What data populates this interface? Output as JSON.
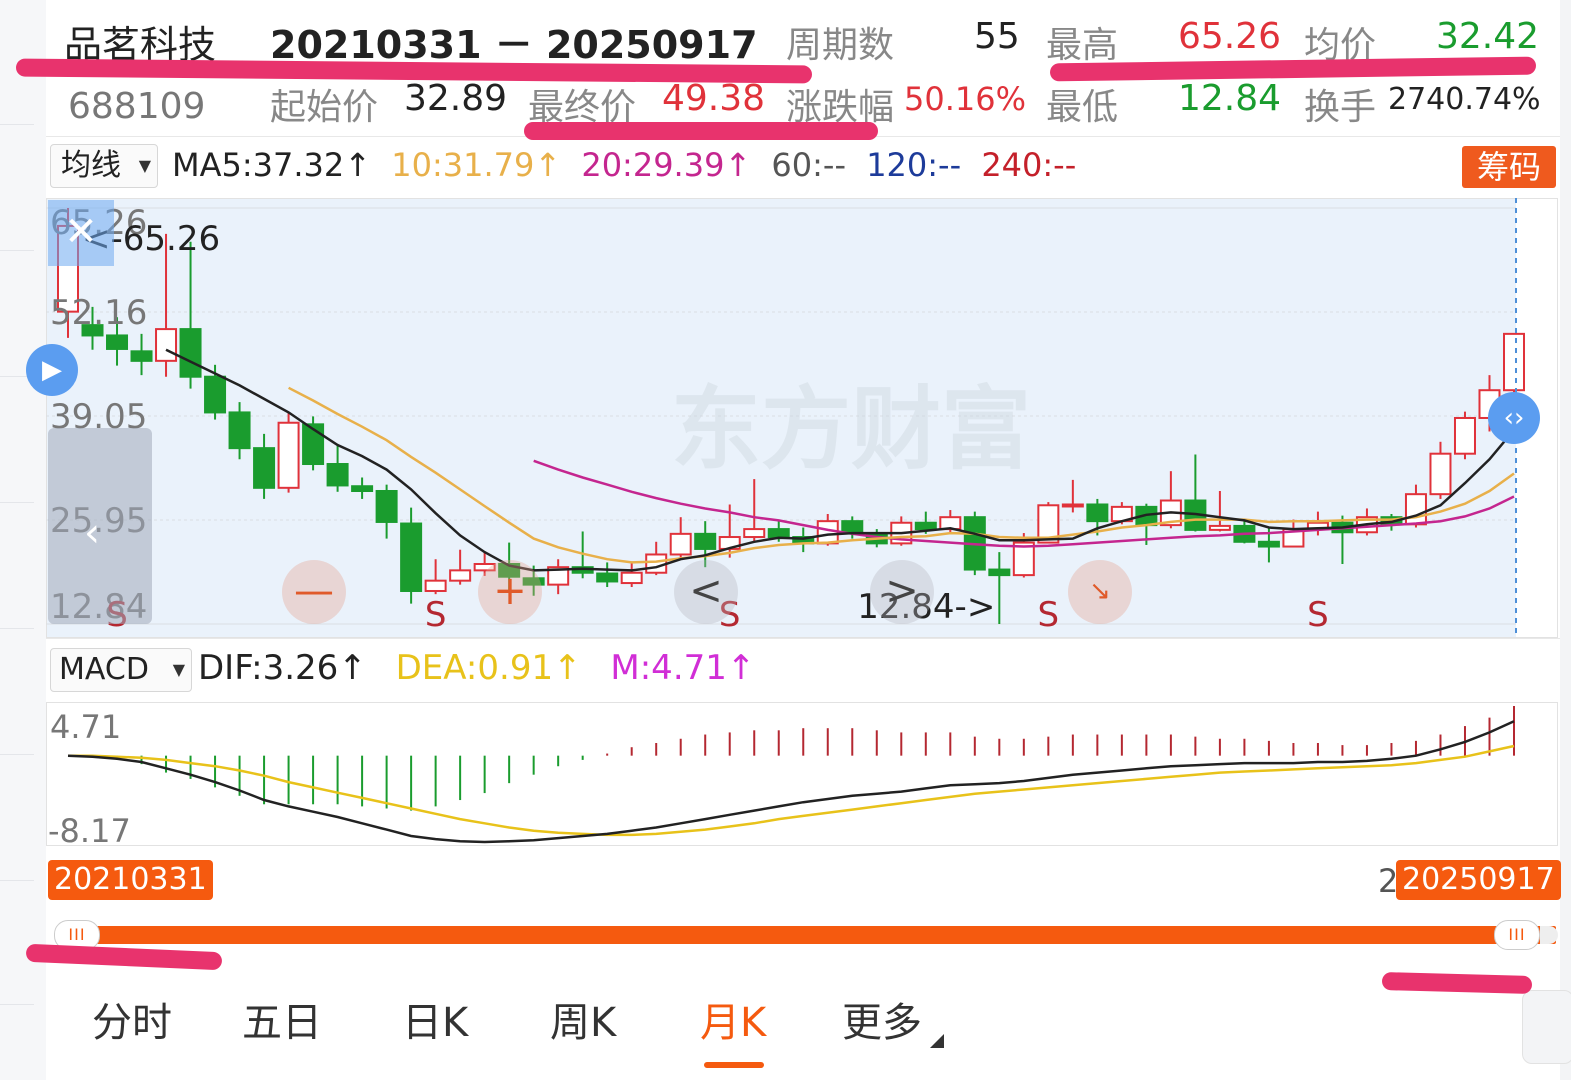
{
  "header": {
    "stock_name": "品茗科技",
    "date_range": "20210331 － 20250917",
    "stock_code": "688109",
    "periods_label": "周期数",
    "periods_value": "55",
    "high_label": "最高",
    "high_value": "65.26",
    "avg_label": "均价",
    "avg_value": "32.42",
    "start_label": "起始价",
    "start_value": "32.89",
    "end_label": "最终价",
    "end_value": "49.38",
    "change_label": "涨跌幅",
    "change_value": "50.16%",
    "low_label": "最低",
    "low_value": "12.84",
    "turnover_label": "换手",
    "turnover_value": "2740.74%"
  },
  "ma_bar": {
    "selector": "均线",
    "ma5": "MA5:37.32↑",
    "ma10": "10:31.79↑",
    "ma20": "20:29.39↑",
    "ma60": "60:--",
    "ma120": "120:--",
    "ma240": "240:--",
    "chip_button": "筹码"
  },
  "colors": {
    "up": "#e0323a",
    "down": "#1a9c2e",
    "ma5": "#222222",
    "ma10": "#e8b04a",
    "ma20": "#c4268f",
    "ma60": "#555555",
    "ma120": "#1d3b9a",
    "ma240": "#c4202a",
    "accent": "#f55a0f"
  },
  "main_chart": {
    "y_labels": [
      "65.26",
      "52.16",
      "39.05",
      "25.95",
      "12.84"
    ],
    "high_marker": "<-65.26",
    "low_marker": "12.84->",
    "watermark": "东方财富",
    "s_markers": [
      "S",
      "S",
      "S",
      "S",
      "S"
    ],
    "zoom_out": "—",
    "zoom_in": "+",
    "prev": "<",
    "next": ">"
  },
  "macd_bar": {
    "selector": "MACD",
    "dif": "DIF:3.26↑",
    "dea": "DEA:0.91↑",
    "m": "M:4.71↑",
    "y_top": "4.71",
    "y_bottom": "-8.17"
  },
  "range_slider": {
    "start": "20210331",
    "end": "20250917",
    "handle_glyph": "III"
  },
  "tabs": [
    {
      "label": "分时",
      "active": false
    },
    {
      "label": "五日",
      "active": false
    },
    {
      "label": "日K",
      "active": false
    },
    {
      "label": "周K",
      "active": false
    },
    {
      "label": "月K",
      "active": true
    },
    {
      "label": "更多",
      "active": false
    }
  ],
  "chart_data": {
    "type": "candlestick",
    "ylim": [
      12.84,
      65.26
    ],
    "candles": [
      [
        52.2,
        63.0,
        65.26,
        48.9
      ],
      [
        50.5,
        49.2,
        52.8,
        47.4
      ],
      [
        49.2,
        47.5,
        51.5,
        45.4
      ],
      [
        47.2,
        46.0,
        49.4,
        44.2
      ],
      [
        46.0,
        50.0,
        62.0,
        44.0
      ],
      [
        50.0,
        44.0,
        61.0,
        42.5
      ],
      [
        44.0,
        39.5,
        45.5,
        38.6
      ],
      [
        39.5,
        35.0,
        40.8,
        33.6
      ],
      [
        35.0,
        30.0,
        36.8,
        28.6
      ],
      [
        30.0,
        38.2,
        39.5,
        29.4
      ],
      [
        38.0,
        33.0,
        39.0,
        32.2
      ],
      [
        33.0,
        30.3,
        35.5,
        29.5
      ],
      [
        30.2,
        29.6,
        31.3,
        28.6
      ],
      [
        29.6,
        25.7,
        30.4,
        23.6
      ],
      [
        25.5,
        17.0,
        27.5,
        15.4
      ],
      [
        17.0,
        18.3,
        21.0,
        16.6
      ],
      [
        18.3,
        19.6,
        22.2,
        17.8
      ],
      [
        19.6,
        20.4,
        21.9,
        18.9
      ],
      [
        20.4,
        18.8,
        23.1,
        17.0
      ],
      [
        18.6,
        17.8,
        20.2,
        16.4
      ],
      [
        17.8,
        20.0,
        21.0,
        16.6
      ],
      [
        20.0,
        19.3,
        24.5,
        18.6
      ],
      [
        19.2,
        18.2,
        20.6,
        17.5
      ],
      [
        18.0,
        19.3,
        20.6,
        17.5
      ],
      [
        19.3,
        21.6,
        23.2,
        19.0
      ],
      [
        21.6,
        24.2,
        26.3,
        21.2
      ],
      [
        24.2,
        22.3,
        25.8,
        20.0
      ],
      [
        22.3,
        23.8,
        27.9,
        21.2
      ],
      [
        23.8,
        24.8,
        31.1,
        23.2
      ],
      [
        24.8,
        23.8,
        26.0,
        23.2
      ],
      [
        23.8,
        23.0,
        25.0,
        21.9
      ],
      [
        23.0,
        25.8,
        26.7,
        22.7
      ],
      [
        25.8,
        24.3,
        26.4,
        23.6
      ],
      [
        24.3,
        23.0,
        24.8,
        22.5
      ],
      [
        23.0,
        25.6,
        26.4,
        22.7
      ],
      [
        25.6,
        24.8,
        27.0,
        24.2
      ],
      [
        24.8,
        26.3,
        27.2,
        24.3
      ],
      [
        26.3,
        19.7,
        27.0,
        19.0
      ],
      [
        19.7,
        19.0,
        21.9,
        12.84
      ],
      [
        19.0,
        23.1,
        24.3,
        18.7
      ],
      [
        23.1,
        27.8,
        28.2,
        23.0
      ],
      [
        27.8,
        27.9,
        31.0,
        26.9
      ],
      [
        27.9,
        25.8,
        28.6,
        24.0
      ],
      [
        25.8,
        27.6,
        28.2,
        25.4
      ],
      [
        27.6,
        25.3,
        28.0,
        22.8
      ],
      [
        25.3,
        28.4,
        32.1,
        24.9
      ],
      [
        28.4,
        24.7,
        34.2,
        24.5
      ],
      [
        24.7,
        25.2,
        29.6,
        24.5
      ],
      [
        25.2,
        23.2,
        26.0,
        23.0
      ],
      [
        23.2,
        22.6,
        24.9,
        20.6
      ],
      [
        22.6,
        24.8,
        26.0,
        22.5
      ],
      [
        24.8,
        25.6,
        27.0,
        24.0
      ],
      [
        25.6,
        24.4,
        26.5,
        20.4
      ],
      [
        24.4,
        26.3,
        27.4,
        24.0
      ],
      [
        26.3,
        25.4,
        26.7,
        24.6
      ],
      [
        25.4,
        29.2,
        30.4,
        25.0
      ],
      [
        29.2,
        34.3,
        35.8,
        28.6
      ],
      [
        34.3,
        38.8,
        39.6,
        33.6
      ],
      [
        38.8,
        42.3,
        44.2,
        37.1
      ],
      [
        42.3,
        49.4,
        49.4,
        41.0
      ]
    ],
    "ma5": [
      null,
      null,
      null,
      null,
      47.4,
      45.9,
      44.4,
      42.9,
      41.2,
      39.5,
      37.4,
      35.4,
      34.0,
      32.3,
      29.8,
      26.8,
      24.0,
      21.9,
      20.2,
      19.6,
      19.7,
      19.8,
      19.7,
      19.6,
      20.0,
      21.0,
      21.5,
      22.4,
      23.2,
      23.7,
      23.6,
      24.1,
      24.3,
      24.3,
      24.3,
      24.6,
      24.9,
      24.2,
      23.4,
      23.4,
      23.5,
      23.6,
      24.9,
      25.8,
      26.6,
      26.9,
      26.7,
      26.3,
      25.9,
      25.0,
      24.8,
      24.9,
      25.0,
      25.4,
      25.7,
      26.5,
      27.8,
      30.6,
      33.6,
      37.3
    ],
    "ma10": [
      null,
      null,
      null,
      null,
      null,
      null,
      null,
      null,
      null,
      42.6,
      41.0,
      39.3,
      37.7,
      36.0,
      33.9,
      31.9,
      29.8,
      27.7,
      25.6,
      23.6,
      22.5,
      21.7,
      21.0,
      20.6,
      20.7,
      21.1,
      21.4,
      21.8,
      22.4,
      22.8,
      23.0,
      23.1,
      23.4,
      23.6,
      23.8,
      23.9,
      24.3,
      24.2,
      23.8,
      23.7,
      23.7,
      24.1,
      24.5,
      25.0,
      25.3,
      25.7,
      26.0,
      26.0,
      26.0,
      25.7,
      25.8,
      25.8,
      25.9,
      26.0,
      26.0,
      26.3,
      27.0,
      28.0,
      29.6,
      31.8
    ],
    "ma20": [
      null,
      null,
      null,
      null,
      null,
      null,
      null,
      null,
      null,
      null,
      null,
      null,
      null,
      null,
      null,
      null,
      null,
      null,
      null,
      33.4,
      32.3,
      31.3,
      30.4,
      29.5,
      28.7,
      28.0,
      27.4,
      26.9,
      26.3,
      25.9,
      25.3,
      24.7,
      24.2,
      23.8,
      23.5,
      23.3,
      23.1,
      22.9,
      22.7,
      22.6,
      22.7,
      22.9,
      23.1,
      23.3,
      23.5,
      23.7,
      23.9,
      24.0,
      24.2,
      24.3,
      24.5,
      24.7,
      24.9,
      25.1,
      25.3,
      25.5,
      25.8,
      26.4,
      27.4,
      28.9
    ],
    "macd_dif": [
      0.0,
      -0.1,
      -0.3,
      -0.6,
      -1.2,
      -1.8,
      -2.5,
      -3.3,
      -4.2,
      -4.8,
      -5.3,
      -5.8,
      -6.4,
      -7.0,
      -7.6,
      -7.9,
      -8.1,
      -8.17,
      -8.1,
      -8.0,
      -7.8,
      -7.6,
      -7.4,
      -7.1,
      -6.8,
      -6.4,
      -6.0,
      -5.6,
      -5.2,
      -4.8,
      -4.4,
      -4.1,
      -3.8,
      -3.6,
      -3.4,
      -3.1,
      -2.8,
      -2.7,
      -2.6,
      -2.4,
      -2.1,
      -1.8,
      -1.6,
      -1.4,
      -1.2,
      -1.0,
      -0.9,
      -0.8,
      -0.7,
      -0.7,
      -0.7,
      -0.6,
      -0.6,
      -0.5,
      -0.3,
      0.0,
      0.6,
      1.3,
      2.2,
      3.26
    ],
    "macd_dea": [
      0.0,
      0.0,
      -0.1,
      -0.2,
      -0.4,
      -0.7,
      -1.0,
      -1.4,
      -1.9,
      -2.5,
      -3.0,
      -3.5,
      -4.0,
      -4.5,
      -5.0,
      -5.5,
      -6.0,
      -6.4,
      -6.8,
      -7.1,
      -7.3,
      -7.4,
      -7.5,
      -7.5,
      -7.4,
      -7.2,
      -7.0,
      -6.7,
      -6.4,
      -6.0,
      -5.7,
      -5.4,
      -5.1,
      -4.8,
      -4.5,
      -4.2,
      -3.9,
      -3.6,
      -3.4,
      -3.2,
      -3.0,
      -2.8,
      -2.6,
      -2.4,
      -2.2,
      -2.0,
      -1.8,
      -1.6,
      -1.5,
      -1.4,
      -1.3,
      -1.2,
      -1.1,
      -1.0,
      -0.9,
      -0.7,
      -0.4,
      -0.1,
      0.4,
      0.91
    ]
  }
}
